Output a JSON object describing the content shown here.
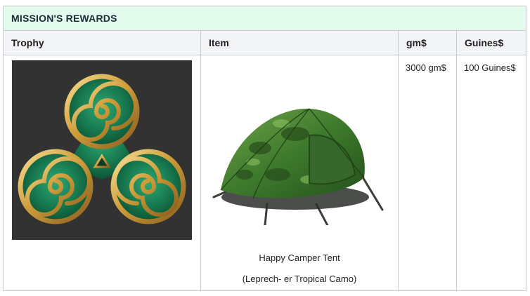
{
  "table": {
    "title": "MISSION'S REWARDS",
    "headers": {
      "trophy": "Trophy",
      "item": "Item",
      "gm": "gm$",
      "guines": "Guines$"
    },
    "row": {
      "trophy_image": "triskele-trophy",
      "item_image": "camo-tent",
      "item_name": "Happy Camper Tent",
      "item_variant": "(Leprech- er Tropical Camo)",
      "gm_value": "3000 gm$",
      "guines_value": "100 Guines$"
    }
  },
  "colors": {
    "title_bg": "#e3fbec",
    "header_bg": "#f3f4f6",
    "border": "#c8ccd1",
    "trophy_bg": "#323232",
    "gold": "#d4a849",
    "malachite": "#1f7a52"
  }
}
